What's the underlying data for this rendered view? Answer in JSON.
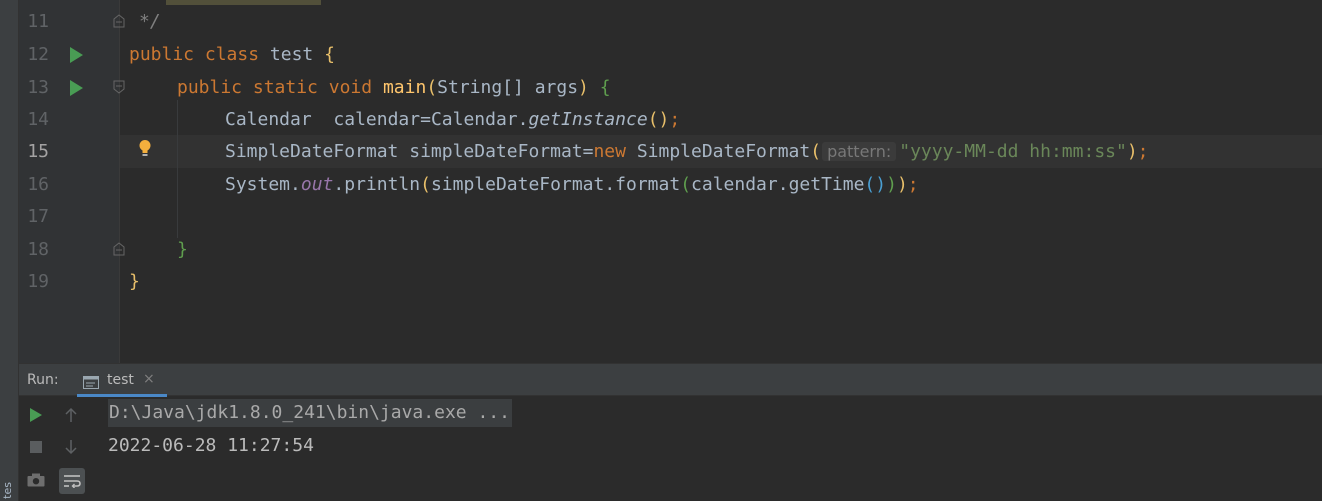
{
  "left_strip": {
    "text": "tes"
  },
  "editor": {
    "line_numbers": [
      "11",
      "12",
      "13",
      "14",
      "15",
      "16",
      "17",
      "18",
      "19"
    ],
    "active_line": "15",
    "lines": {
      "l11": {
        "comment": "*/"
      },
      "l12": {
        "kw_public": "public",
        "kw_class": "class",
        "name": "test",
        "brace": "{"
      },
      "l13": {
        "kw_public": "public",
        "kw_static": "static",
        "kw_void": "void",
        "method": "main",
        "paren_open": "(",
        "params": "String[] args",
        "paren_close": ")",
        "brace": "{"
      },
      "l14": {
        "type": "Calendar",
        "spaces": "  ",
        "var": "calendar",
        "eq": "=",
        "cls": "Calendar",
        "dot": ".",
        "call": "getInstance",
        "parens": "()",
        "semi": ";"
      },
      "l15": {
        "type": "SimpleDateFormat",
        "var": "simpleDateFormat",
        "eq": "=",
        "kw_new": "new",
        "ctor": "SimpleDateFormat",
        "paren_open": "(",
        "hint": "pattern:",
        "string": "\"yyyy-MM-dd hh:mm:ss\"",
        "paren_close": ")",
        "semi": ";"
      },
      "l16": {
        "sys": "System",
        "dot1": ".",
        "out": "out",
        "dot2": ".println",
        "p1": "(",
        "obj": "simpleDateFormat.format",
        "p2": "(",
        "arg": "calendar.getTime",
        "p3": "()",
        "p4": ")",
        "p5": ")",
        "semi": ";"
      },
      "l18": {
        "brace": "}"
      },
      "l19": {
        "brace": "}"
      }
    }
  },
  "run_panel": {
    "label": "Run:",
    "tab_label": "test",
    "tab_close": "×",
    "console_lines": [
      "D:\\Java\\jdk1.8.0_241\\bin\\java.exe ...",
      "2022-06-28 11:27:54"
    ]
  },
  "colors": {
    "keyword": "#cc7832",
    "method": "#ffc66d",
    "string": "#6a8759",
    "text": "#a9b7c6",
    "run_icon": "#499c54"
  },
  "icons": [
    "run-gutter-icon",
    "fold-icon",
    "intention-bulb-icon",
    "rerun-icon",
    "stop-icon",
    "camera-icon",
    "scroll-up-icon",
    "scroll-down-icon",
    "soft-wrap-icon",
    "console-tab-icon"
  ]
}
